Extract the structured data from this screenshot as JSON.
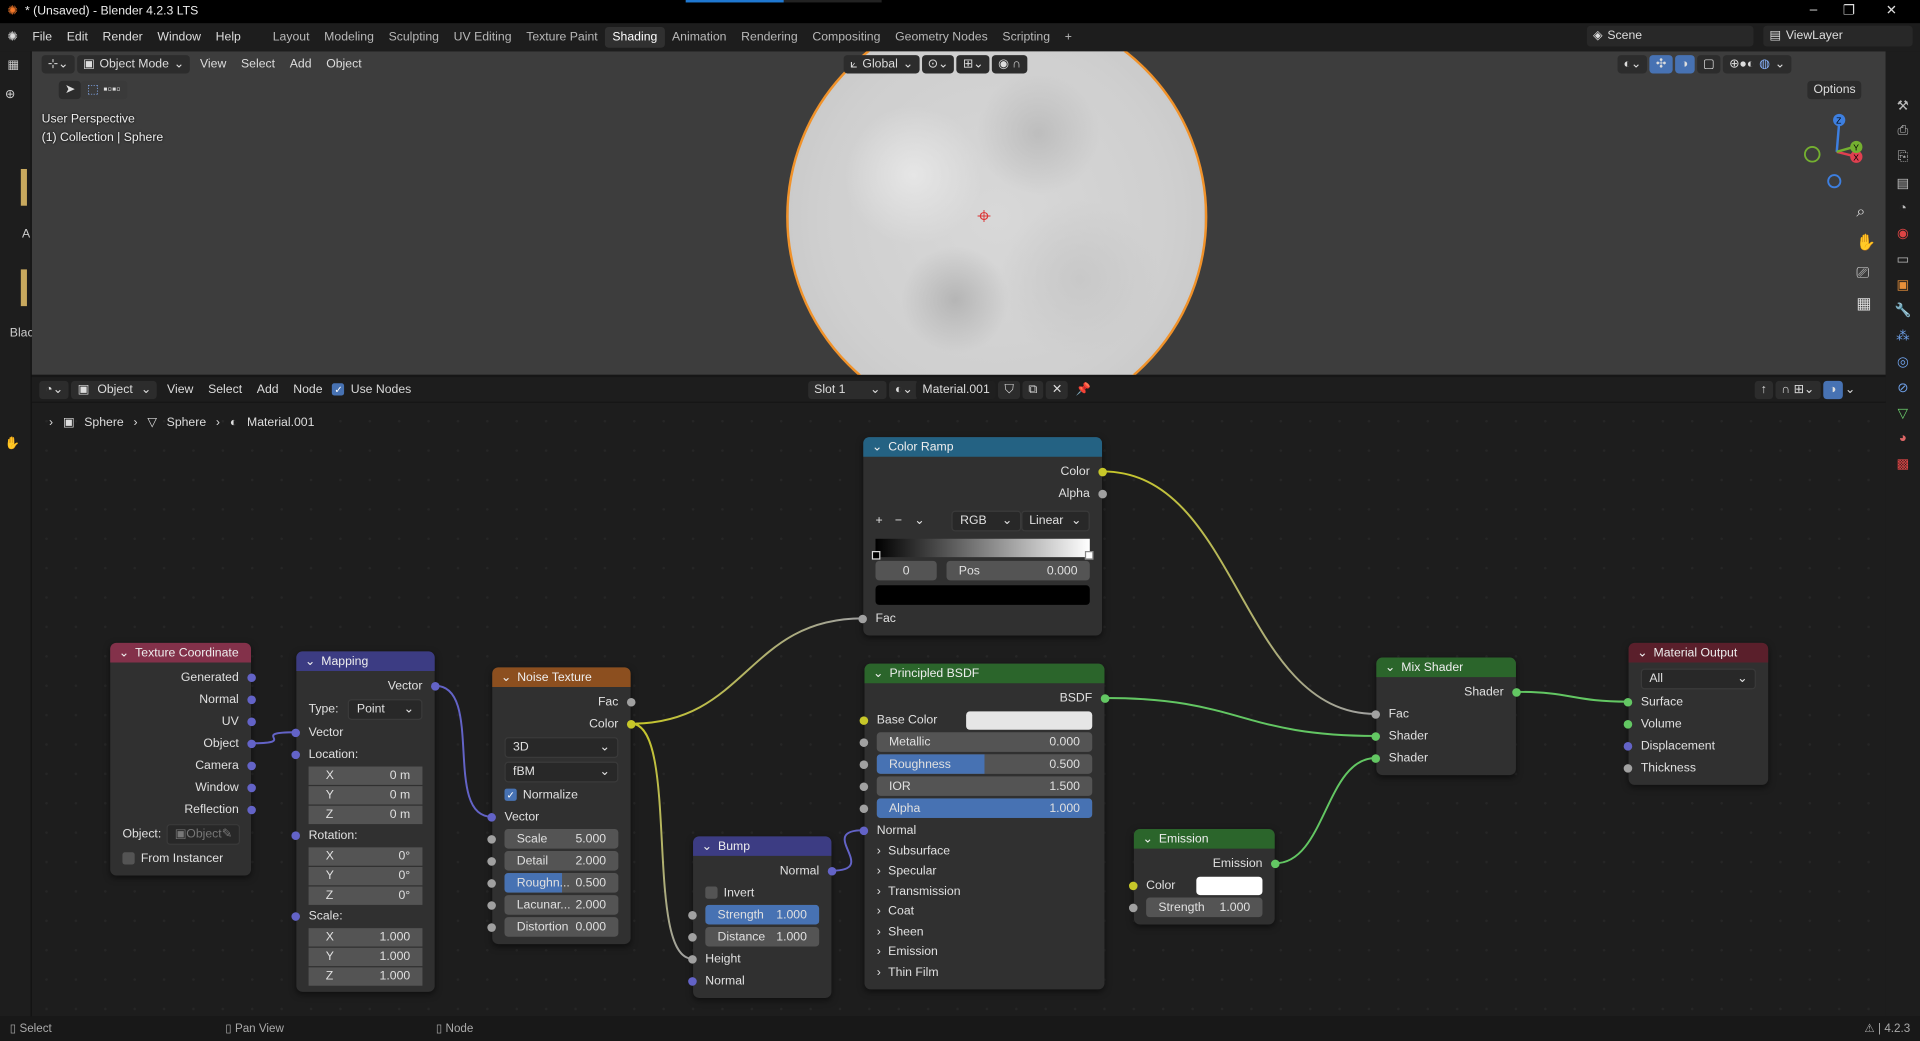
{
  "window": {
    "title": "* (Unsaved) - Blender 4.2.3 LTS",
    "controls": [
      "–",
      "❐",
      "✕"
    ],
    "load_progress": 0.5
  },
  "topbar": {
    "menus": [
      "File",
      "Edit",
      "Render",
      "Window",
      "Help"
    ],
    "workspaces": [
      "Layout",
      "Modeling",
      "Sculpting",
      "UV Editing",
      "Texture Paint",
      "Shading",
      "Animation",
      "Rendering",
      "Compositing",
      "Geometry Nodes",
      "Scripting"
    ],
    "active_workspace": "Shading",
    "add_tab": "+",
    "scene": "Scene",
    "view_layer": "ViewLayer"
  },
  "left_strip": {
    "labels": [
      "A",
      "Blac"
    ]
  },
  "viewport": {
    "mode": "Object Mode",
    "menus": [
      "View",
      "Select",
      "Add",
      "Object"
    ],
    "orientation": "Global",
    "options": "Options",
    "overlay_line1": "User Perspective",
    "overlay_line2": "(1) Collection | Sphere",
    "gizmo_axes": [
      "X",
      "Y",
      "Z"
    ],
    "selected_outline": "#f0922a"
  },
  "node_editor": {
    "object_type": "Object",
    "menus": [
      "View",
      "Select",
      "Add",
      "Node"
    ],
    "use_nodes_label": "Use Nodes",
    "use_nodes": true,
    "slot": "Slot 1",
    "material": "Material.001",
    "breadcrumb": [
      "Sphere",
      "Sphere",
      "Material.001"
    ]
  },
  "socket_colors": {
    "vector": "#6363c7",
    "color": "#c7c729",
    "float": "#a1a1a1",
    "shader": "#63c763"
  },
  "nodes": [
    {
      "id": "texcoord",
      "title": "Texture Coordinate",
      "color": "#83314a",
      "rows": [
        {
          "t": "out",
          "label": "Generated",
          "sock": "vector"
        },
        {
          "t": "out",
          "label": "Normal",
          "sock": "vector"
        },
        {
          "t": "out",
          "label": "UV",
          "sock": "vector"
        },
        {
          "t": "out",
          "label": "Object",
          "sock": "vector"
        },
        {
          "t": "out",
          "label": "Camera",
          "sock": "vector"
        },
        {
          "t": "out",
          "label": "Window",
          "sock": "vector"
        },
        {
          "t": "out",
          "label": "Reflection",
          "sock": "vector"
        },
        {
          "t": "objfield",
          "label": "Object:",
          "value": "Object"
        },
        {
          "t": "check",
          "label": "From Instancer",
          "on": false
        }
      ]
    },
    {
      "id": "mapping",
      "title": "Mapping",
      "color": "#3c3c83",
      "rows": [
        {
          "t": "out",
          "label": "Vector",
          "sock": "vector"
        },
        {
          "t": "select",
          "label": "Type:",
          "value": "Point"
        },
        {
          "t": "in",
          "label": "Vector",
          "sock": "vector"
        },
        {
          "t": "in",
          "label": "Location:",
          "sock": "vector"
        },
        {
          "t": "vfield",
          "label": "X",
          "value": "0 m"
        },
        {
          "t": "vfield",
          "label": "Y",
          "value": "0 m"
        },
        {
          "t": "vfield",
          "label": "Z",
          "value": "0 m"
        },
        {
          "t": "in",
          "label": "Rotation:",
          "sock": "vector"
        },
        {
          "t": "vfield",
          "label": "X",
          "value": "0°"
        },
        {
          "t": "vfield",
          "label": "Y",
          "value": "0°"
        },
        {
          "t": "vfield",
          "label": "Z",
          "value": "0°"
        },
        {
          "t": "in",
          "label": "Scale:",
          "sock": "vector"
        },
        {
          "t": "vfield",
          "label": "X",
          "value": "1.000"
        },
        {
          "t": "vfield",
          "label": "Y",
          "value": "1.000"
        },
        {
          "t": "vfield",
          "label": "Z",
          "value": "1.000"
        }
      ]
    },
    {
      "id": "noise",
      "title": "Noise Texture",
      "color": "#8c4f1f",
      "rows": [
        {
          "t": "out",
          "label": "Fac",
          "sock": "float"
        },
        {
          "t": "out",
          "label": "Color",
          "sock": "color"
        },
        {
          "t": "select",
          "value": "3D"
        },
        {
          "t": "select",
          "value": "fBM"
        },
        {
          "t": "check",
          "label": "Normalize",
          "on": true
        },
        {
          "t": "in",
          "label": "Vector",
          "sock": "vector"
        },
        {
          "t": "field",
          "label": "Scale",
          "value": "5.000",
          "sock": "float"
        },
        {
          "t": "field",
          "label": "Detail",
          "value": "2.000",
          "sock": "float"
        },
        {
          "t": "field",
          "label": "Roughn...",
          "value": "0.500",
          "fill": 0.5,
          "sock": "float"
        },
        {
          "t": "field",
          "label": "Lacunar...",
          "value": "2.000",
          "sock": "float"
        },
        {
          "t": "field",
          "label": "Distortion",
          "value": "0.000",
          "sock": "float"
        }
      ]
    },
    {
      "id": "ramp",
      "title": "Color Ramp",
      "color": "#246283",
      "rows": [
        {
          "t": "out",
          "label": "Color",
          "sock": "color"
        },
        {
          "t": "out",
          "label": "Alpha",
          "sock": "float"
        },
        {
          "t": "ramptools",
          "add": "+",
          "remove": "−",
          "menu": "⌄",
          "mode": "RGB",
          "interp": "Linear"
        },
        {
          "t": "gradient",
          "from": "#000000",
          "to": "#ffffff"
        },
        {
          "t": "rampstop",
          "index": "0",
          "label": "Pos",
          "value": "0.000"
        },
        {
          "t": "swatch",
          "color": "#000000"
        },
        {
          "t": "in",
          "label": "Fac",
          "sock": "float"
        }
      ]
    },
    {
      "id": "bsdf",
      "title": "Principled BSDF",
      "color": "#2b652b",
      "rows": [
        {
          "t": "out",
          "label": "BSDF",
          "sock": "shader"
        },
        {
          "t": "colorin",
          "label": "Base Color",
          "color": "#e6e6e6",
          "sock": "color"
        },
        {
          "t": "field",
          "label": "Metallic",
          "value": "0.000",
          "sock": "float"
        },
        {
          "t": "field",
          "label": "Roughness",
          "value": "0.500",
          "fill": 0.5,
          "sock": "float"
        },
        {
          "t": "field",
          "label": "IOR",
          "value": "1.500",
          "sock": "float"
        },
        {
          "t": "field",
          "label": "Alpha",
          "value": "1.000",
          "fill": 1,
          "sock": "float"
        },
        {
          "t": "in",
          "label": "Normal",
          "sock": "vector"
        },
        {
          "t": "panel",
          "label": "Subsurface"
        },
        {
          "t": "panel",
          "label": "Specular"
        },
        {
          "t": "panel",
          "label": "Transmission"
        },
        {
          "t": "panel",
          "label": "Coat"
        },
        {
          "t": "panel",
          "label": "Sheen"
        },
        {
          "t": "panel",
          "label": "Emission"
        },
        {
          "t": "panel",
          "label": "Thin Film"
        }
      ]
    },
    {
      "id": "bump",
      "title": "Bump",
      "color": "#3c3c83",
      "rows": [
        {
          "t": "out",
          "label": "Normal",
          "sock": "vector"
        },
        {
          "t": "check",
          "label": "Invert",
          "on": false
        },
        {
          "t": "field",
          "label": "Strength",
          "value": "1.000",
          "fill": 1,
          "sock": "float"
        },
        {
          "t": "field",
          "label": "Distance",
          "value": "1.000",
          "sock": "float"
        },
        {
          "t": "in",
          "label": "Height",
          "sock": "float"
        },
        {
          "t": "in",
          "label": "Normal",
          "sock": "vector"
        }
      ]
    },
    {
      "id": "emission",
      "title": "Emission",
      "color": "#2b652b",
      "rows": [
        {
          "t": "out",
          "label": "Emission",
          "sock": "shader"
        },
        {
          "t": "colorin",
          "label": "Color",
          "color": "#ffffff",
          "sock": "color"
        },
        {
          "t": "field",
          "label": "Strength",
          "value": "1.000",
          "sock": "float"
        }
      ]
    },
    {
      "id": "mix",
      "title": "Mix Shader",
      "color": "#2b652b",
      "rows": [
        {
          "t": "out",
          "label": "Shader",
          "sock": "shader"
        },
        {
          "t": "in",
          "label": "Fac",
          "sock": "float"
        },
        {
          "t": "in",
          "label": "Shader",
          "sock": "shader"
        },
        {
          "t": "in",
          "label": "Shader",
          "sock": "shader"
        }
      ]
    },
    {
      "id": "output",
      "title": "Material Output",
      "color": "#5a1f2b",
      "rows": [
        {
          "t": "select",
          "value": "All"
        },
        {
          "t": "in",
          "label": "Surface",
          "sock": "shader"
        },
        {
          "t": "in",
          "label": "Volume",
          "sock": "shader"
        },
        {
          "t": "in",
          "label": "Displacement",
          "sock": "vector"
        },
        {
          "t": "in",
          "label": "Thickness",
          "sock": "float"
        }
      ]
    }
  ],
  "links": [
    {
      "from": "texcoord.out.Object",
      "to": "mapping.in.Vector"
    },
    {
      "from": "mapping.out.Vector",
      "to": "noise.in.Vector"
    },
    {
      "from": "noise.out.Color",
      "to": "ramp.in.Fac"
    },
    {
      "from": "noise.out.Color",
      "to": "bump.in.Height"
    },
    {
      "from": "bump.out.Normal",
      "to": "bsdf.in.Normal"
    },
    {
      "from": "ramp.out.Color",
      "to": "mix.in.Fac"
    },
    {
      "from": "bsdf.out.BSDF",
      "to": "mix.in.Shader"
    },
    {
      "from": "emission.out.Emission",
      "to": "mix.in.Shader#2"
    },
    {
      "from": "mix.out.Shader",
      "to": "output.in.Surface"
    }
  ],
  "statusbar": {
    "items": [
      "Select",
      "Pan View",
      "Node"
    ],
    "version": "4.2.3"
  }
}
